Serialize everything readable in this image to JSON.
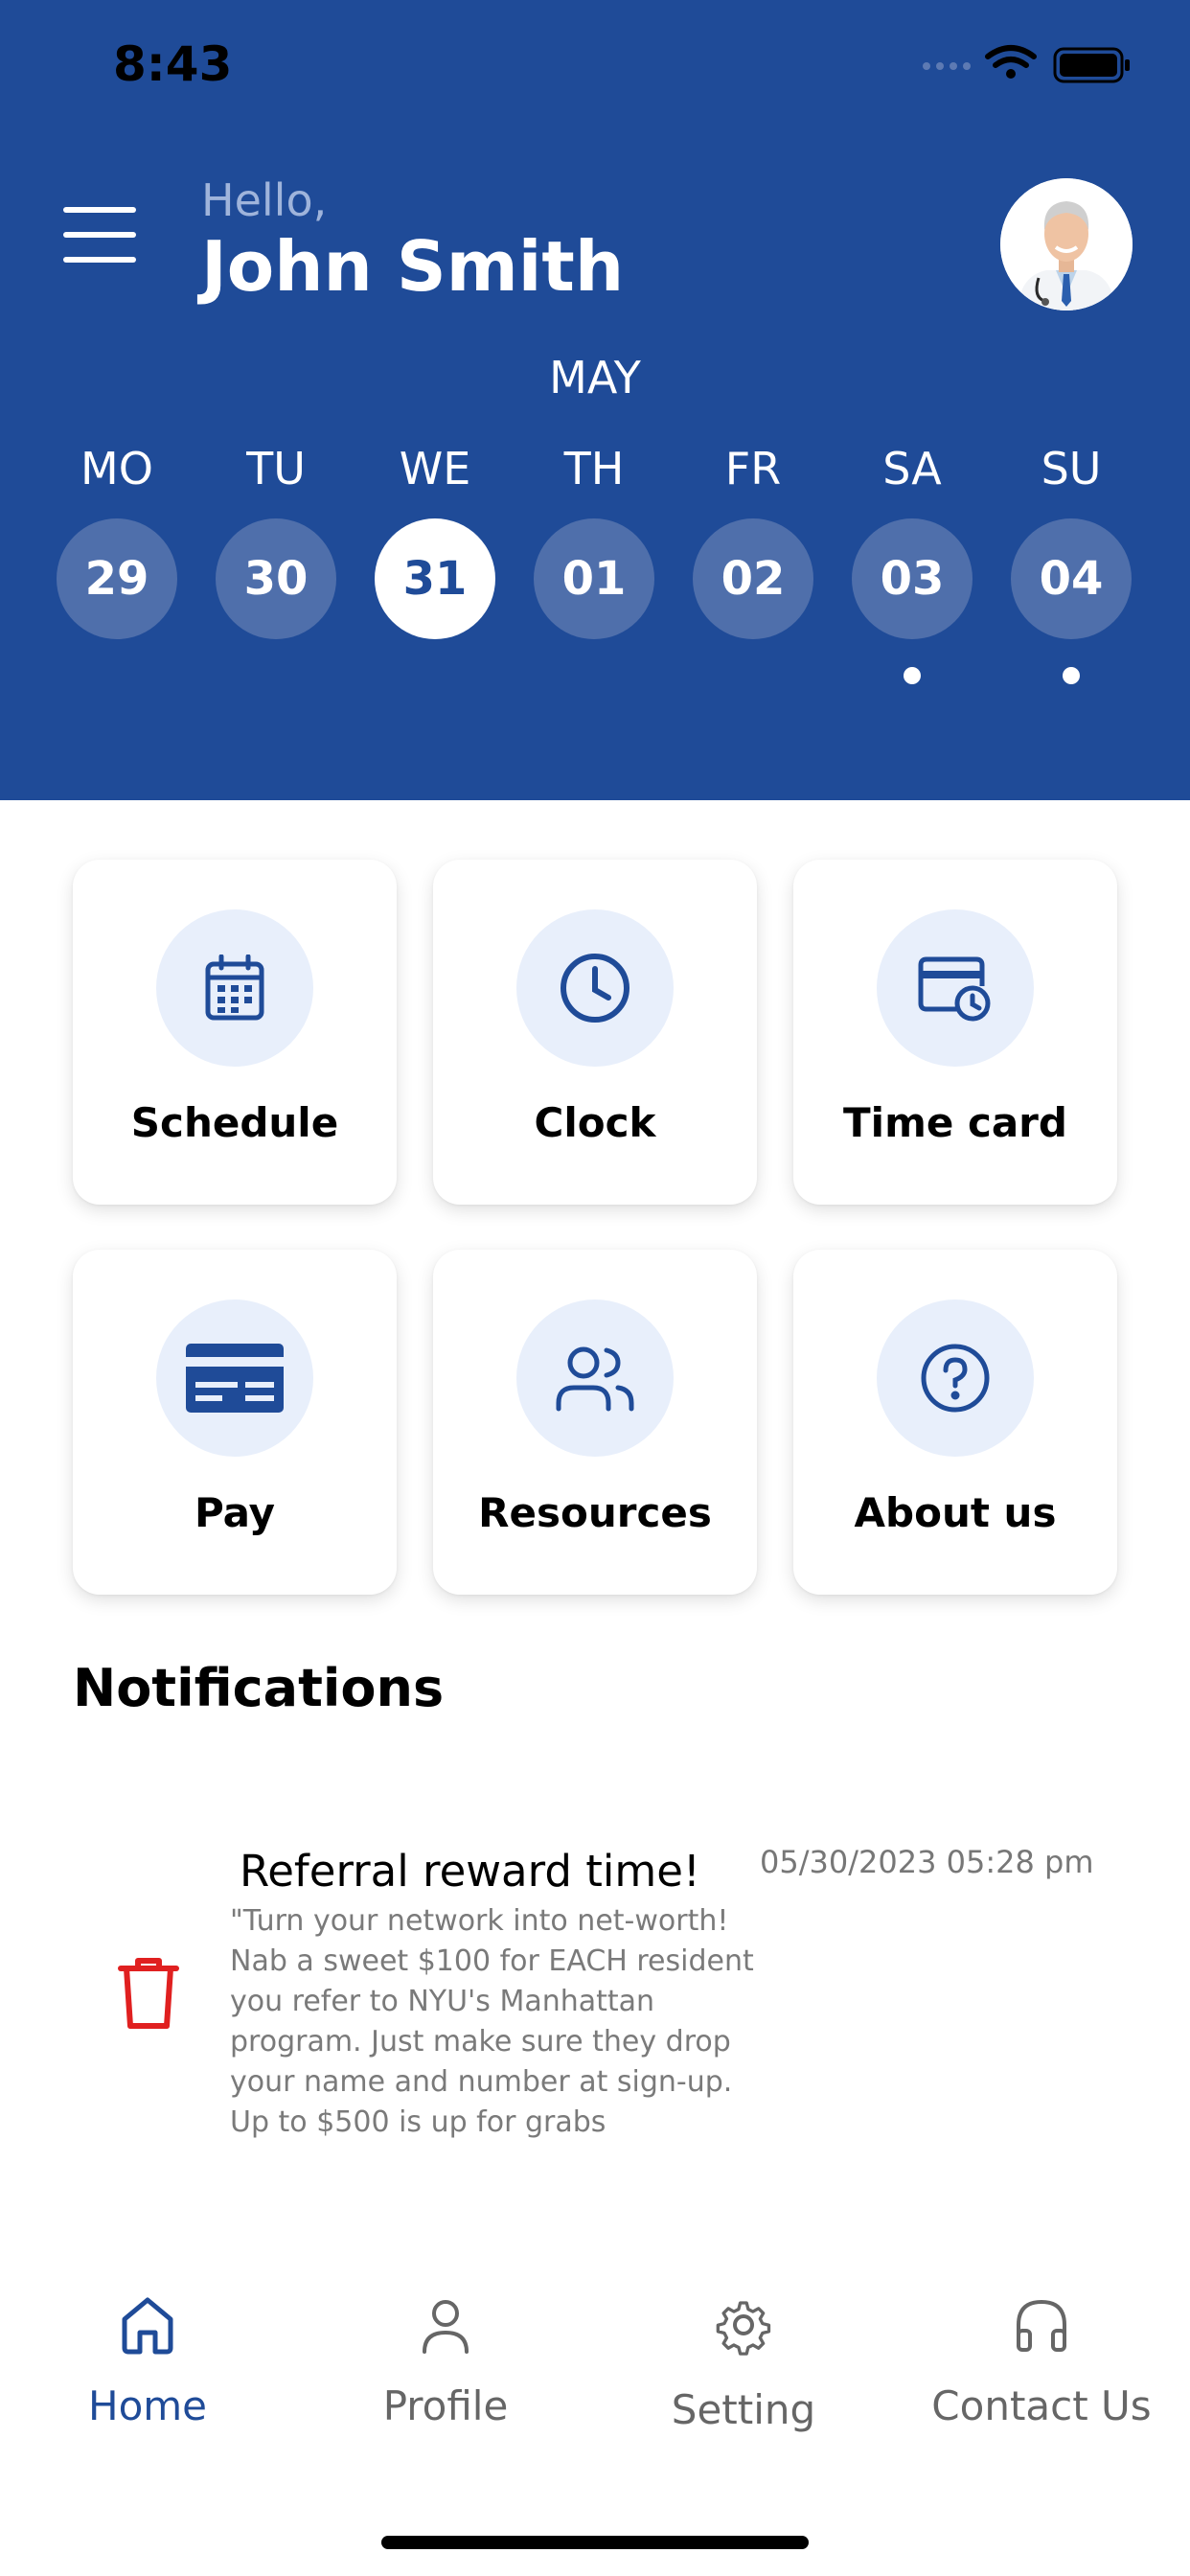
{
  "status_bar": {
    "time": "8:43"
  },
  "header": {
    "greeting": "Hello,",
    "user_name": "John Smith",
    "month": "MAY",
    "week": [
      {
        "day": "MO",
        "date": "29",
        "active": false,
        "has_event": false
      },
      {
        "day": "TU",
        "date": "30",
        "active": false,
        "has_event": false
      },
      {
        "day": "WE",
        "date": "31",
        "active": true,
        "has_event": false
      },
      {
        "day": "TH",
        "date": "01",
        "active": false,
        "has_event": false
      },
      {
        "day": "FR",
        "date": "02",
        "active": false,
        "has_event": false
      },
      {
        "day": "SA",
        "date": "03",
        "active": false,
        "has_event": true
      },
      {
        "day": "SU",
        "date": "04",
        "active": false,
        "has_event": true
      }
    ]
  },
  "tiles": [
    {
      "label": "Schedule",
      "icon": "calendar-icon"
    },
    {
      "label": "Clock",
      "icon": "clock-icon"
    },
    {
      "label": "Time card",
      "icon": "time-card-icon"
    },
    {
      "label": "Pay",
      "icon": "credit-card-icon"
    },
    {
      "label": "Resources",
      "icon": "users-icon"
    },
    {
      "label": "About us",
      "icon": "help-circle-icon"
    }
  ],
  "notifications": {
    "heading": "Notifications",
    "items": [
      {
        "title": "Referral reward time!",
        "date": "05/30/2023 05:28 pm",
        "body": "\"Turn your network into net-worth!\nNab a sweet $100 for EACH resident\nyou refer to NYU's Manhattan\nprogram. Just make sure they drop\nyour name and number at sign-up.\nUp to $500 is up for grabs"
      }
    ]
  },
  "bottom_nav": [
    {
      "label": "Home",
      "icon": "home-icon",
      "active": true
    },
    {
      "label": "Profile",
      "icon": "user-icon",
      "active": false
    },
    {
      "label": "Setting",
      "icon": "gear-icon",
      "active": false
    },
    {
      "label": "Contact Us",
      "icon": "headphones-icon",
      "active": false
    }
  ],
  "colors": {
    "primary": "#1f4b98",
    "date_circle": "#4f6fab",
    "tile_icon_bg": "#e8effb",
    "delete_red": "#e02020"
  }
}
